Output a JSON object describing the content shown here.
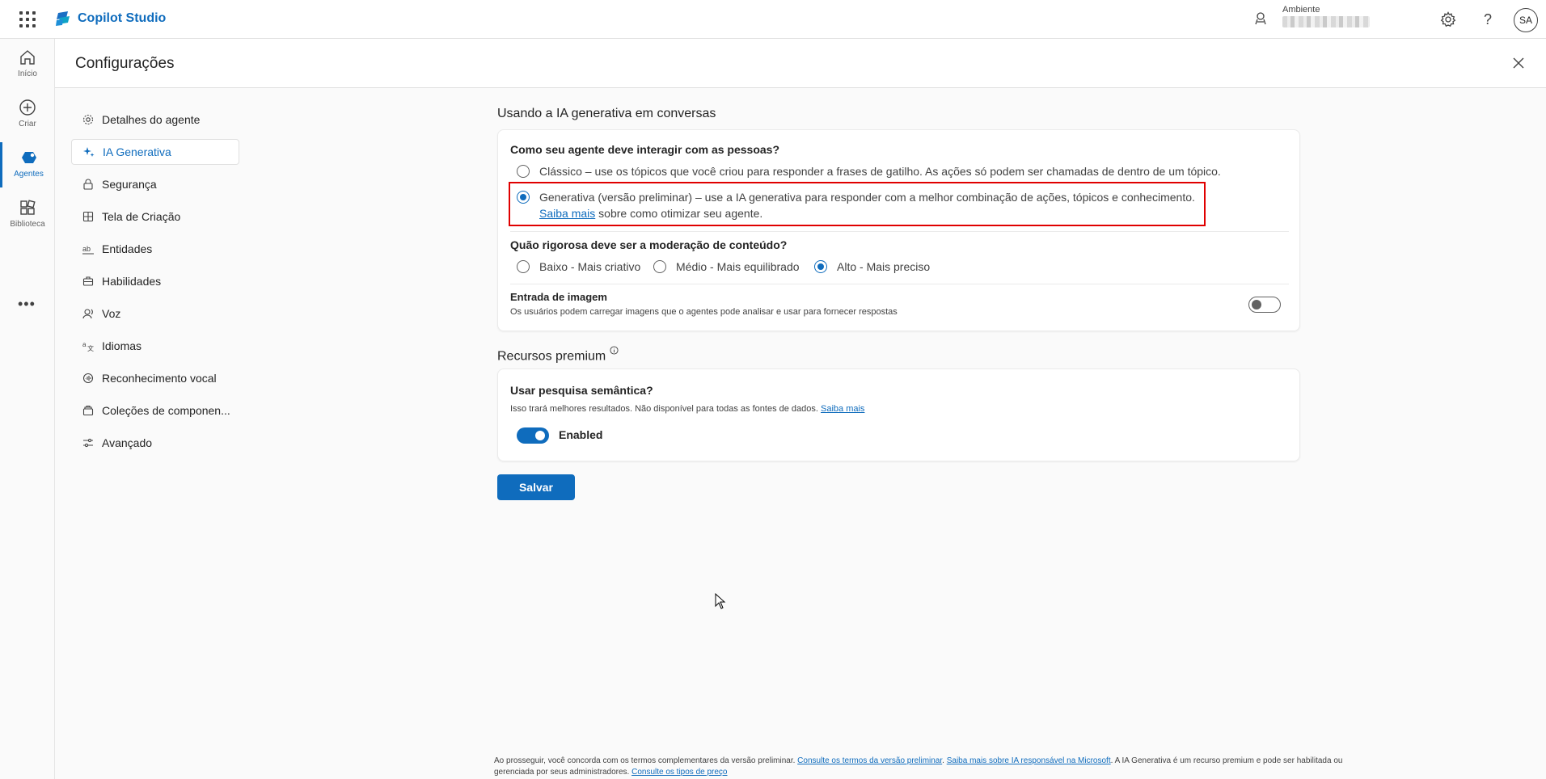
{
  "app": {
    "name": "Copilot Studio"
  },
  "env": {
    "label": "Ambiente"
  },
  "user": {
    "initials": "SA"
  },
  "rail": [
    {
      "label": "Início",
      "icon": "home-icon"
    },
    {
      "label": "Criar",
      "icon": "plus-circle-icon"
    },
    {
      "label": "Agentes",
      "icon": "agents-icon"
    },
    {
      "label": "Biblioteca",
      "icon": "library-icon"
    }
  ],
  "panel": {
    "title": "Configurações"
  },
  "nav": [
    {
      "label": "Detalhes do agente",
      "icon": "gear-icon"
    },
    {
      "label": "IA Generativa",
      "icon": "sparkle-icon",
      "active": true
    },
    {
      "label": "Segurança",
      "icon": "lock-icon"
    },
    {
      "label": "Tela de Criação",
      "icon": "grid-icon"
    },
    {
      "label": "Entidades",
      "icon": "entities-icon"
    },
    {
      "label": "Habilidades",
      "icon": "briefcase-icon"
    },
    {
      "label": "Voz",
      "icon": "voice-icon"
    },
    {
      "label": "Idiomas",
      "icon": "translate-icon"
    },
    {
      "label": "Reconhecimento vocal",
      "icon": "speech-icon"
    },
    {
      "label": "Coleções de componen...",
      "icon": "collection-icon"
    },
    {
      "label": "Avançado",
      "icon": "sliders-icon"
    }
  ],
  "generative": {
    "section_title": "Usando a IA generativa em conversas",
    "interaction_question": "Como seu agente deve interagir com as pessoas?",
    "option_classic": "Clássico – use os tópicos que você criou para responder a frases de gatilho. As ações só podem ser chamadas de dentro de um tópico.",
    "option_generative": "Generativa (versão preliminar) – use a IA generativa para responder com a melhor combinação de ações, tópicos e conhecimento.",
    "learn_more": "Saiba mais",
    "learn_more_suffix": " sobre como otimizar seu agente.",
    "selected": "generative",
    "moderation_question": "Quão rigorosa deve ser a moderação de conteúdo?",
    "moderation_options": [
      "Baixo - Mais criativo",
      "Médio - Mais equilibrado",
      "Alto - Mais preciso"
    ],
    "moderation_selected": "Alto - Mais preciso",
    "image_input_title": "Entrada de imagem",
    "image_input_desc": "Os usuários podem carregar imagens que o agentes pode analisar e usar para fornecer respostas",
    "image_input_enabled": false
  },
  "premium": {
    "section_title": "Recursos premium",
    "semantic_question": "Usar pesquisa semântica?",
    "semantic_desc": "Isso trará melhores resultados. Não disponível para todas as fontes de dados.",
    "semantic_link": "Saiba mais",
    "toggle_label": "Enabled",
    "semantic_enabled": true
  },
  "save_button": "Salvar",
  "footer": {
    "t1": "Ao prosseguir, você concorda com os termos complementares da versão preliminar. ",
    "l1": "Consulte os termos da versão preliminar",
    "t2": ". ",
    "l2": "Saiba mais sobre IA responsável na Microsoft",
    "t3": ". A IA Generativa é um recurso premium e pode ser habilitada ou gerenciada por seus administradores. ",
    "l3": "Consulte os tipos de preço"
  },
  "colors": {
    "accent": "#0f6cbd",
    "highlight": "#e00000"
  }
}
